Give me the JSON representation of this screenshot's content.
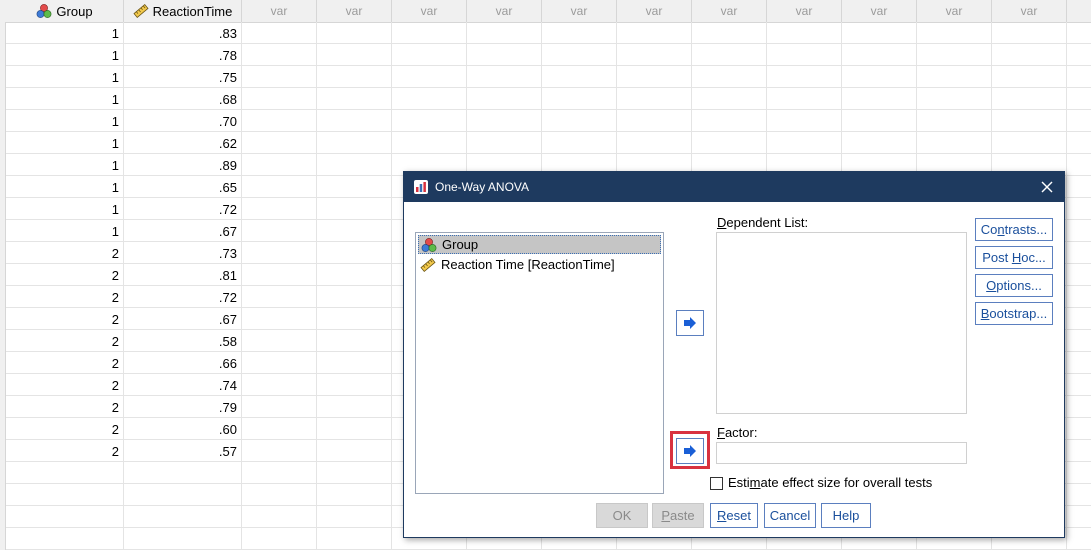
{
  "columns": [
    {
      "name": "Group",
      "icon": "nominal-icon"
    },
    {
      "name": "ReactionTime",
      "icon": "scale-icon"
    },
    {
      "name": "var"
    },
    {
      "name": "var"
    },
    {
      "name": "var"
    },
    {
      "name": "var"
    },
    {
      "name": "var"
    },
    {
      "name": "var"
    },
    {
      "name": "var"
    },
    {
      "name": "var"
    },
    {
      "name": "var"
    },
    {
      "name": "var"
    },
    {
      "name": "var"
    }
  ],
  "rows": [
    [
      "1",
      ".83"
    ],
    [
      "1",
      ".78"
    ],
    [
      "1",
      ".75"
    ],
    [
      "1",
      ".68"
    ],
    [
      "1",
      ".70"
    ],
    [
      "1",
      ".62"
    ],
    [
      "1",
      ".89"
    ],
    [
      "1",
      ".65"
    ],
    [
      "1",
      ".72"
    ],
    [
      "1",
      ".67"
    ],
    [
      "2",
      ".73"
    ],
    [
      "2",
      ".81"
    ],
    [
      "2",
      ".72"
    ],
    [
      "2",
      ".67"
    ],
    [
      "2",
      ".58"
    ],
    [
      "2",
      ".66"
    ],
    [
      "2",
      ".74"
    ],
    [
      "2",
      ".79"
    ],
    [
      "2",
      ".60"
    ],
    [
      "2",
      ".57"
    ]
  ],
  "dialog": {
    "title": "One-Way ANOVA",
    "variables": [
      {
        "label": "Group",
        "icon": "nominal-icon",
        "selected": true
      },
      {
        "label": "Reaction Time [ReactionTime]",
        "icon": "scale-icon",
        "selected": false
      }
    ],
    "dependent_list_label_mnemonic": "D",
    "dependent_list_label_rest": "ependent List:",
    "factor_label_mnemonic": "F",
    "factor_label_rest": "actor:",
    "checkbox": {
      "pre": "Esti",
      "mnemonic": "m",
      "post": "ate effect size for overall tests",
      "checked": false
    },
    "side_buttons": [
      {
        "pre": "Co",
        "mnemonic": "n",
        "post": "trasts..."
      },
      {
        "pre": "Post ",
        "mnemonic": "H",
        "post": "oc..."
      },
      {
        "pre": "",
        "mnemonic": "O",
        "post": "ptions..."
      },
      {
        "pre": "",
        "mnemonic": "B",
        "post": "ootstrap..."
      }
    ],
    "bottom_buttons": [
      {
        "pre": "OK",
        "mnemonic": "",
        "post": "",
        "enabled": false
      },
      {
        "pre": "",
        "mnemonic": "P",
        "post": "aste",
        "enabled": false
      },
      {
        "pre": "",
        "mnemonic": "R",
        "post": "eset",
        "enabled": true
      },
      {
        "pre": "Cancel",
        "mnemonic": "",
        "post": "",
        "enabled": true
      },
      {
        "pre": "Help",
        "mnemonic": "",
        "post": "",
        "enabled": true
      }
    ]
  },
  "colors": {
    "titlebar": "#1e3a5f",
    "highlight": "#d9323f",
    "button_text": "#1a4f9c"
  }
}
